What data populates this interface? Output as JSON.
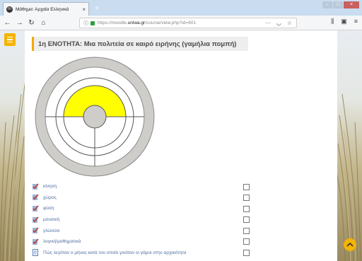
{
  "browser": {
    "tab_title": "Μάθημα: Αρχαία Ελληνικά",
    "tab_close": "×",
    "new_tab": "+",
    "url_prefix": "https://moodle.",
    "url_host": "uniwa.gr",
    "url_path": "/course/view.php?id=601",
    "url_more": "···",
    "icons": {
      "back": "back-arrow-icon",
      "forward": "forward-arrow-icon",
      "reload": "reload-icon",
      "home": "home-icon",
      "info": "info-icon",
      "lock": "lock-icon",
      "pocket": "pocket-icon",
      "bookmark": "star-icon",
      "library": "library-icon",
      "sidebar": "sidebar-icon",
      "menu": "hamburger-icon"
    }
  },
  "section": {
    "title": "1η ΕΝΟΤΗΤΑ: Μια πολιτεία σε καιρό ειρήνης (γαμήλια πομπή)"
  },
  "diagram": {
    "outer_ring_color": "#cfcdc9",
    "highlight_color": "#ffff00",
    "center_color": "#cfcdc9"
  },
  "activities": [
    {
      "label": "κίνηση",
      "icon": "check-pencil-icon",
      "completed": true
    },
    {
      "label": "χώρος",
      "icon": "check-pencil-icon",
      "completed": true
    },
    {
      "label": "φύση",
      "icon": "check-pencil-icon",
      "completed": true
    },
    {
      "label": "μουσική",
      "icon": "check-pencil-icon",
      "completed": true
    },
    {
      "label": "γλώσσα",
      "icon": "check-pencil-icon",
      "completed": true
    },
    {
      "label": "λογική/μαθηματικά",
      "icon": "check-pencil-icon",
      "completed": true
    },
    {
      "label": "Πώς λεγόταν ο μήνας κατά τον οποίο γινόταν οι γάμοι στην αρχαιότητα",
      "icon": "page-icon",
      "completed": false
    }
  ],
  "colors": {
    "accent": "#f4b400",
    "link": "#4f6fa0"
  }
}
